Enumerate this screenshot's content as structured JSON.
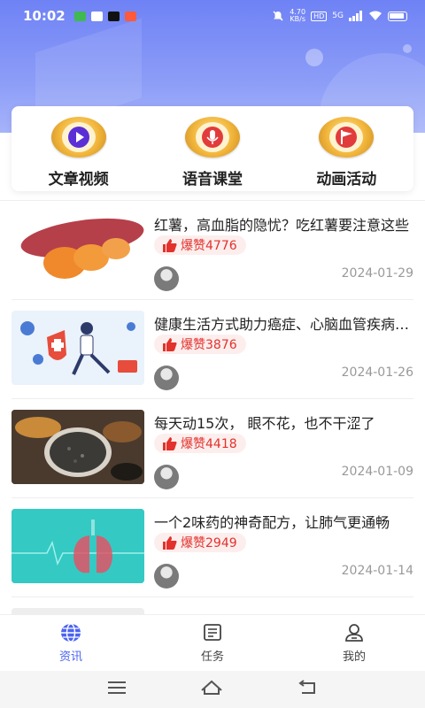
{
  "status_bar": {
    "time": "10:02",
    "speed": "4.70",
    "speed_unit": "KB/s",
    "hd": "HD",
    "network": "5G"
  },
  "categories": [
    {
      "label": "文章视频",
      "icon": "play-icon"
    },
    {
      "label": "语音课堂",
      "icon": "microphone-icon"
    },
    {
      "label": "动画活动",
      "icon": "flag-icon"
    }
  ],
  "articles": [
    {
      "title": "红薯，高血脂的隐忧？吃红薯要注意这些",
      "likes": "爆赞4776",
      "date": "2024-01-29"
    },
    {
      "title": "健康生活方式助力癌症、心脑血管疾病预防",
      "likes": "爆赞3876",
      "date": "2024-01-26"
    },
    {
      "title": "每天动15次， 眼不花，也不干涩了",
      "likes": "爆赞4418",
      "date": "2024-01-09"
    },
    {
      "title": "一个2味药的神奇配方，让肺气更通畅",
      "likes": "爆赞2949",
      "date": "2024-01-14"
    }
  ],
  "tabs": [
    {
      "label": "资讯",
      "icon": "globe-icon",
      "active": true
    },
    {
      "label": "任务",
      "icon": "task-list-icon",
      "active": false
    },
    {
      "label": "我的",
      "icon": "profile-icon",
      "active": false
    }
  ],
  "colors": {
    "accent": "#4a63f0",
    "like_red": "#e2322b",
    "header_blue": "#7b8ef6"
  }
}
